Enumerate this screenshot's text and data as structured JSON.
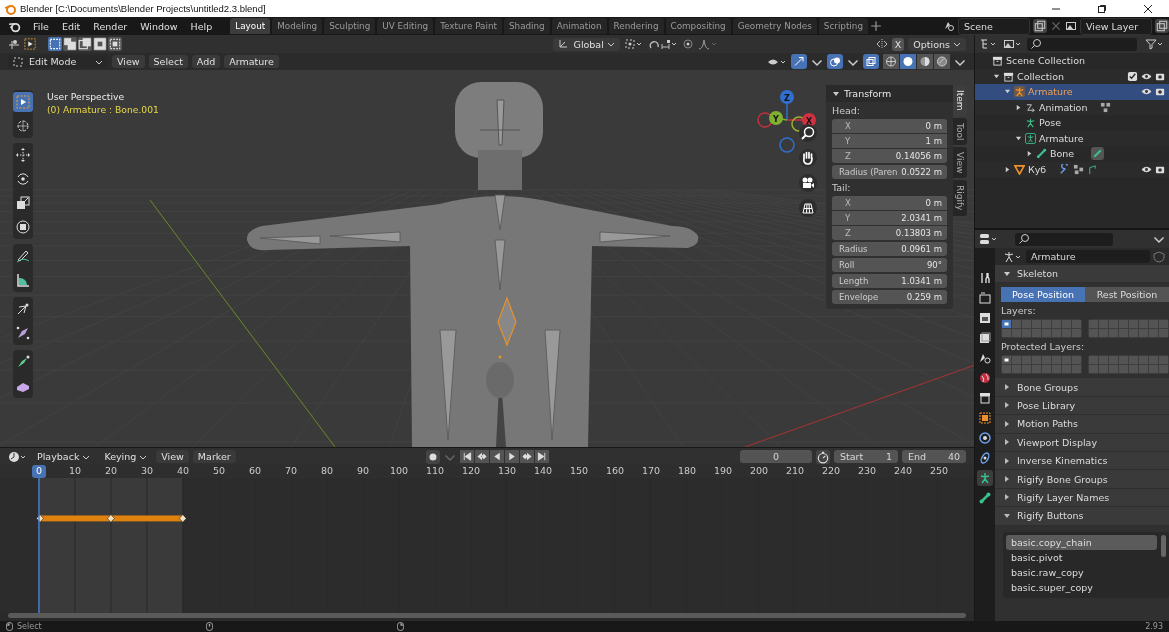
{
  "window": {
    "title": "Blender [C:\\Documents\\Blender Projects\\untitled2.3.blend]"
  },
  "menu": [
    "File",
    "Edit",
    "Render",
    "Window",
    "Help"
  ],
  "workspaces": [
    {
      "label": "Layout",
      "selected": true
    },
    {
      "label": "Modeling",
      "selected": false
    },
    {
      "label": "Sculpting",
      "selected": false
    },
    {
      "label": "UV Editing",
      "selected": false
    },
    {
      "label": "Texture Paint",
      "selected": false
    },
    {
      "label": "Shading",
      "selected": false
    },
    {
      "label": "Animation",
      "selected": false
    },
    {
      "label": "Rendering",
      "selected": false
    },
    {
      "label": "Compositing",
      "selected": false
    },
    {
      "label": "Geometry Nodes",
      "selected": false
    },
    {
      "label": "Scripting",
      "selected": false
    }
  ],
  "scene": {
    "name": "Scene"
  },
  "view_layer": {
    "name": "View Layer"
  },
  "viewport": {
    "transform_orientation": "Global",
    "mirror": "X",
    "options": "Options",
    "mode": "Edit Mode",
    "menus": [
      "View",
      "Select",
      "Add",
      "Armature"
    ],
    "shading": [
      {
        "kind": "wireframe",
        "selected": false
      },
      {
        "kind": "solid",
        "selected": true
      },
      {
        "kind": "material",
        "selected": false
      },
      {
        "kind": "rendered",
        "selected": false
      }
    ],
    "tool_groups": [
      {
        "tools": [
          {
            "kind": "select",
            "selected": true
          },
          {
            "kind": "cursor",
            "selected": false
          }
        ]
      },
      {
        "tools": [
          {
            "kind": "move",
            "selected": false
          },
          {
            "kind": "rotate",
            "selected": false
          },
          {
            "kind": "scale",
            "selected": false
          },
          {
            "kind": "transform",
            "selected": false
          }
        ]
      },
      {
        "tools": [
          {
            "kind": "annotate",
            "selected": false
          },
          {
            "kind": "measure",
            "selected": false
          }
        ]
      },
      {
        "tools": [
          {
            "kind": "roll",
            "selected": false
          },
          {
            "kind": "bone_size",
            "selected": false
          }
        ]
      },
      {
        "tools": [
          {
            "kind": "extrude",
            "selected": false
          },
          {
            "kind": "shear",
            "selected": false
          }
        ]
      }
    ],
    "overlay": {
      "view": "User Perspective",
      "object": "(0) Armature : Bone.001"
    },
    "gizmo_axes": [
      "Z",
      "Y",
      "X"
    ],
    "sidebar_tabs": [
      {
        "label": "Item",
        "selected": true
      },
      {
        "label": "Tool",
        "selected": false
      },
      {
        "label": "View",
        "selected": false
      },
      {
        "label": "Rigify",
        "selected": false
      }
    ],
    "transform": {
      "title": "Transform",
      "head_label": "Head:",
      "head": [
        {
          "label": "X",
          "value": "0 m"
        },
        {
          "label": "Y",
          "value": "1 m"
        },
        {
          "label": "Z",
          "value": "0.14056 m"
        }
      ],
      "head_radius": {
        "label": "Radius (Paren",
        "value": "0.0522 m"
      },
      "tail_label": "Tail:",
      "tail": [
        {
          "label": "X",
          "value": "0 m"
        },
        {
          "label": "Y",
          "value": "2.0341 m"
        },
        {
          "label": "Z",
          "value": "0.13803 m"
        }
      ],
      "extra": [
        {
          "label": "Radius",
          "value": "0.0961 m"
        },
        {
          "label": "Roll",
          "value": "90°"
        },
        {
          "label": "Length",
          "value": "1.0341 m"
        },
        {
          "label": "Envelope",
          "value": "0.259 m"
        }
      ]
    }
  },
  "outliner": {
    "tree": [
      {
        "label": "Scene Collection",
        "kind": "scene_collection",
        "selected": false,
        "children": [
          {
            "label": "Collection",
            "kind": "collection",
            "selected": false,
            "expanded": true,
            "checked": true,
            "visible": true,
            "children": [
              {
                "label": "Armature",
                "kind": "armature",
                "selected": true,
                "expanded": true,
                "visible": true,
                "children": [
                  {
                    "label": "Animation",
                    "kind": "animation",
                    "selected": false,
                    "expanded": false
                  },
                  {
                    "label": "Pose",
                    "kind": "pose",
                    "selected": false
                  },
                  {
                    "label": "Armature",
                    "kind": "armature_data",
                    "selected": false,
                    "expanded": true,
                    "children": [
                      {
                        "label": "Bone",
                        "kind": "bone",
                        "selected": false,
                        "expanded": false
                      }
                    ]
                  }
                ]
              },
              {
                "label": "Куб",
                "kind": "mesh",
                "selected": false,
                "expanded": false,
                "visible": true
              }
            ]
          }
        ]
      }
    ]
  },
  "properties": {
    "tabs": [
      {
        "kind": "tool",
        "selected": false
      },
      {
        "kind": "render",
        "selected": false
      },
      {
        "kind": "output",
        "selected": false
      },
      {
        "kind": "view_layer",
        "selected": false
      },
      {
        "kind": "scene",
        "selected": false
      },
      {
        "kind": "world",
        "selected": false
      },
      {
        "kind": "collection",
        "selected": false
      },
      {
        "kind": "object",
        "selected": false
      },
      {
        "kind": "physics",
        "selected": false
      },
      {
        "kind": "constraints",
        "selected": false
      },
      {
        "kind": "armature_data",
        "selected": true
      },
      {
        "kind": "bone",
        "selected": false
      }
    ],
    "data_name": "Armature",
    "skeleton": {
      "title": "Skeleton",
      "expanded": true,
      "positions": [
        {
          "label": "Pose Position",
          "selected": true
        },
        {
          "label": "Rest Position",
          "selected": false
        }
      ],
      "layers_label": "Layers:",
      "protected_label": "Protected Layers:"
    },
    "panels": [
      {
        "title": "Bone Groups",
        "expanded": false
      },
      {
        "title": "Pose Library",
        "expanded": false
      },
      {
        "title": "Motion Paths",
        "expanded": false
      },
      {
        "title": "Viewport Display",
        "expanded": false
      },
      {
        "title": "Inverse Kinematics",
        "expanded": false
      },
      {
        "title": "Rigify Bone Groups",
        "expanded": false
      },
      {
        "title": "Rigify Layer Names",
        "expanded": false
      },
      {
        "title": "Rigify Buttons",
        "expanded": true
      }
    ],
    "rigify_types": [
      {
        "label": "basic.copy_chain",
        "selected": true
      },
      {
        "label": "basic.pivot",
        "selected": false
      },
      {
        "label": "basic.raw_copy",
        "selected": false
      },
      {
        "label": "basic.super_copy",
        "selected": false
      }
    ]
  },
  "timeline": {
    "menus": [
      {
        "label": "Playback",
        "dropdown": true
      },
      {
        "label": "Keying",
        "dropdown": true
      },
      {
        "label": "View",
        "dropdown": false
      },
      {
        "label": "Marker",
        "dropdown": false
      }
    ],
    "current_frame": "0",
    "start_label": "Start",
    "start": "1",
    "end_label": "End",
    "end": "40",
    "frames": [
      {
        "label": "0",
        "selected": true
      },
      {
        "label": "10",
        "selected": false
      },
      {
        "label": "20",
        "selected": false
      },
      {
        "label": "30",
        "selected": false
      },
      {
        "label": "40",
        "selected": false
      },
      {
        "label": "50",
        "selected": false
      },
      {
        "label": "60",
        "selected": false
      },
      {
        "label": "70",
        "selected": false
      },
      {
        "label": "80",
        "selected": false
      },
      {
        "label": "90",
        "selected": false
      },
      {
        "label": "100",
        "selected": false
      },
      {
        "label": "110",
        "selected": false
      },
      {
        "label": "120",
        "selected": false
      },
      {
        "label": "130",
        "selected": false
      },
      {
        "label": "140",
        "selected": false
      },
      {
        "label": "150",
        "selected": false
      },
      {
        "label": "160",
        "selected": false
      },
      {
        "label": "170",
        "selected": false
      },
      {
        "label": "180",
        "selected": false
      },
      {
        "label": "190",
        "selected": false
      },
      {
        "label": "200",
        "selected": false
      },
      {
        "label": "210",
        "selected": false
      },
      {
        "label": "220",
        "selected": false
      },
      {
        "label": "230",
        "selected": false
      },
      {
        "label": "240",
        "selected": false
      },
      {
        "label": "250",
        "selected": false
      }
    ]
  },
  "status_bar": {
    "action": "Select",
    "version": "2.93"
  }
}
